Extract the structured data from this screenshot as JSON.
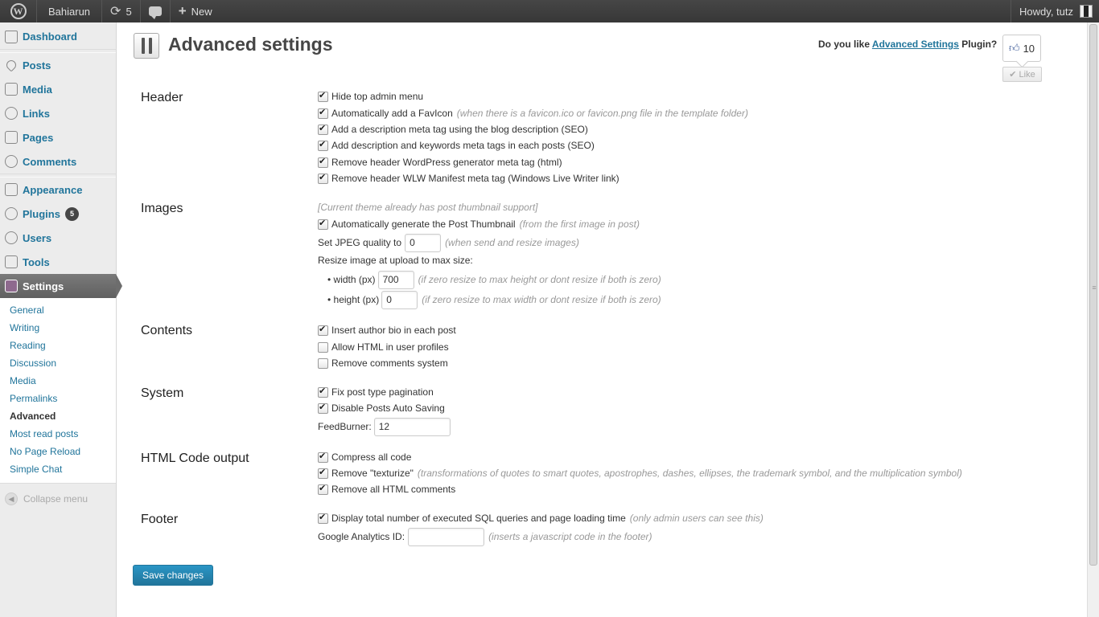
{
  "adminbar": {
    "site_name": "Bahiarun",
    "updates_count": "5",
    "new_label": "New",
    "howdy": "Howdy, tutz"
  },
  "sidebar": {
    "items": [
      {
        "label": "Dashboard",
        "icon": "house-icon"
      },
      {
        "label": "Posts",
        "icon": "pushpin-icon"
      },
      {
        "label": "Media",
        "icon": "media-icon"
      },
      {
        "label": "Links",
        "icon": "link-icon"
      },
      {
        "label": "Pages",
        "icon": "pages-icon"
      },
      {
        "label": "Comments",
        "icon": "comments-icon"
      },
      {
        "label": "Appearance",
        "icon": "appearance-icon"
      },
      {
        "label": "Plugins",
        "icon": "plugin-icon",
        "badge": "5"
      },
      {
        "label": "Users",
        "icon": "users-icon"
      },
      {
        "label": "Tools",
        "icon": "tools-icon"
      },
      {
        "label": "Settings",
        "icon": "settings-icon"
      }
    ],
    "submenu": [
      "General",
      "Writing",
      "Reading",
      "Discussion",
      "Media",
      "Permalinks",
      "Advanced",
      "Most read posts",
      "No Page Reload",
      "Simple Chat"
    ],
    "collapse": "Collapse menu"
  },
  "page": {
    "title": "Advanced settings",
    "like_prompt_pre": "Do you like ",
    "like_prompt_link": "Advanced Settings",
    "like_prompt_post": " Plugin?",
    "like_count": "10",
    "like_button": "Like"
  },
  "sections": {
    "header": {
      "title": "Header",
      "items": [
        {
          "label": "Hide top admin menu",
          "checked": true
        },
        {
          "label": "Automatically add a FavIcon",
          "hint": "(when there is a favicon.ico or favicon.png file in the template folder)",
          "checked": true
        },
        {
          "label": "Add a description meta tag using the blog description (SEO)",
          "checked": true
        },
        {
          "label": "Add description and keywords meta tags in each posts (SEO)",
          "checked": true
        },
        {
          "label": "Remove header WordPress generator meta tag (html)",
          "checked": true
        },
        {
          "label": "Remove header WLW Manifest meta tag (Windows Live Writer link)",
          "checked": true
        }
      ]
    },
    "images": {
      "title": "Images",
      "note": "[Current theme already has post thumbnail support]",
      "thumb_label": "Automatically generate the Post Thumbnail",
      "thumb_hint": "(from the first image in post)",
      "jpeg_label": "Set JPEG quality to",
      "jpeg_value": "0",
      "jpeg_hint": "(when send and resize images)",
      "resize_label": "Resize image at upload to max size:",
      "width_label": "• width (px)",
      "width_value": "700",
      "width_hint": "(if zero resize to max height or dont resize if both is zero)",
      "height_label": "• height (px)",
      "height_value": "0",
      "height_hint": "(if zero resize to max width or dont resize if both is zero)"
    },
    "contents": {
      "title": "Contents",
      "items": [
        {
          "label": "Insert author bio in each post",
          "checked": true
        },
        {
          "label": "Allow HTML in user profiles",
          "checked": false
        },
        {
          "label": "Remove comments system",
          "checked": false
        }
      ]
    },
    "system": {
      "title": "System",
      "items": [
        {
          "label": "Fix post type pagination",
          "checked": true
        },
        {
          "label": "Disable Posts Auto Saving",
          "checked": true
        }
      ],
      "feedburner_label": "FeedBurner:",
      "feedburner_value": "12"
    },
    "html": {
      "title": "HTML Code output",
      "items": [
        {
          "label": "Compress all code",
          "checked": true
        },
        {
          "label": "Remove \"texturize\"",
          "hint": "(transformations of quotes to smart quotes, apostrophes, dashes, ellipses, the trademark symbol, and the multiplication symbol)",
          "checked": true
        },
        {
          "label": "Remove all HTML comments",
          "checked": true
        }
      ]
    },
    "footer": {
      "title": "Footer",
      "sql_label": "Display total number of executed SQL queries and page loading time",
      "sql_hint": "(only admin users can see this)",
      "ga_label": "Google Analytics ID:",
      "ga_value": "",
      "ga_hint": "(inserts a javascript code in the footer)"
    }
  },
  "save_label": "Save changes"
}
